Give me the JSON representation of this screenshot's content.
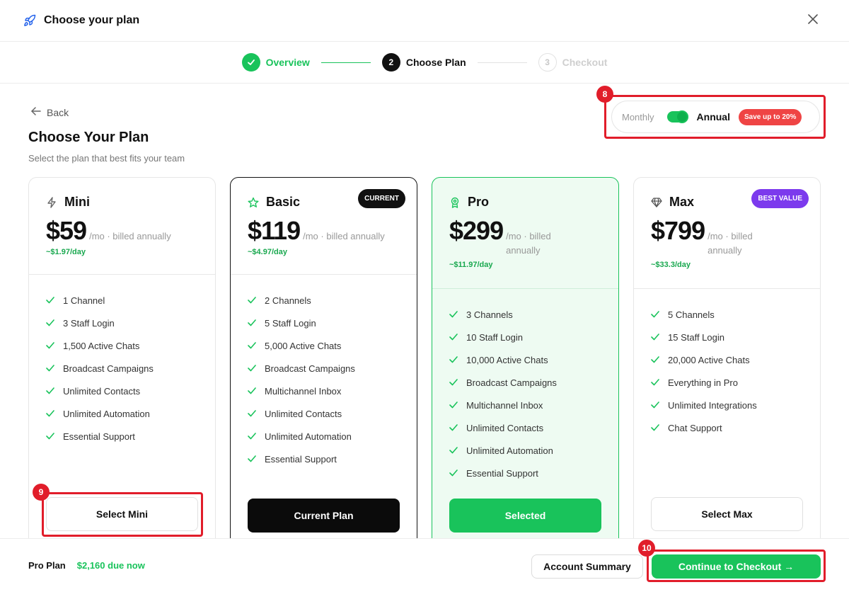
{
  "header": {
    "title": "Choose your plan",
    "icon": "rocket-icon"
  },
  "stepper": {
    "steps": [
      {
        "num": "1",
        "label": "Overview",
        "state": "done"
      },
      {
        "num": "2",
        "label": "Choose Plan",
        "state": "active"
      },
      {
        "num": "3",
        "label": "Checkout",
        "state": "todo"
      }
    ]
  },
  "page": {
    "back_label": "Back",
    "title": "Choose Your Plan",
    "subtitle": "Select the plan that best fits your team"
  },
  "billing": {
    "monthly": "Monthly",
    "annual": "Annual",
    "selected": "Annual",
    "save_badge": "Save up to 20%"
  },
  "annotations": {
    "billing": "8",
    "select_mini": "9",
    "checkout": "10"
  },
  "plans": [
    {
      "name": "Mini",
      "icon": "bolt-icon",
      "price": "$59",
      "per": "/mo · billed annually",
      "daily": "~$1.97/day",
      "features": [
        "1 Channel",
        "3 Staff Login",
        "1,500 Active Chats",
        "Broadcast Campaigns",
        "Unlimited Contacts",
        "Unlimited Automation",
        "Essential Support"
      ],
      "button": "Select Mini"
    },
    {
      "name": "Basic",
      "icon": "star-icon",
      "price": "$119",
      "per": "/mo · billed annually",
      "daily": "~$4.97/day",
      "tag": "CURRENT",
      "features": [
        "2 Channels",
        "5 Staff Login",
        "5,000 Active Chats",
        "Broadcast Campaigns",
        "Multichannel Inbox",
        "Unlimited Contacts",
        "Unlimited Automation",
        "Essential Support"
      ],
      "button": "Current Plan"
    },
    {
      "name": "Pro",
      "icon": "award-icon",
      "price": "$299",
      "per": "/mo · billed annually",
      "daily": "~$11.97/day",
      "features": [
        "3 Channels",
        "10 Staff Login",
        "10,000 Active Chats",
        "Broadcast Campaigns",
        "Multichannel Inbox",
        "Unlimited Contacts",
        "Unlimited Automation",
        "Essential Support"
      ],
      "button": "Selected"
    },
    {
      "name": "Max",
      "icon": "diamond-icon",
      "price": "$799",
      "per": "/mo · billed annually",
      "daily": "~$33.3/day",
      "tag": "BEST VALUE",
      "features": [
        "5 Channels",
        "15 Staff Login",
        "20,000 Active Chats",
        "Everything in Pro",
        "Unlimited Integrations",
        "Chat Support"
      ],
      "button": "Select Max"
    }
  ],
  "footer": {
    "plan": "Pro Plan",
    "due": "$2,160 due now",
    "account_summary": "Account Summary",
    "checkout": "Continue to Checkout →"
  },
  "colors": {
    "accent": "#19c35b",
    "highlight": "#e11d2a",
    "best_value": "#7c3aed",
    "save": "#ef4444"
  }
}
